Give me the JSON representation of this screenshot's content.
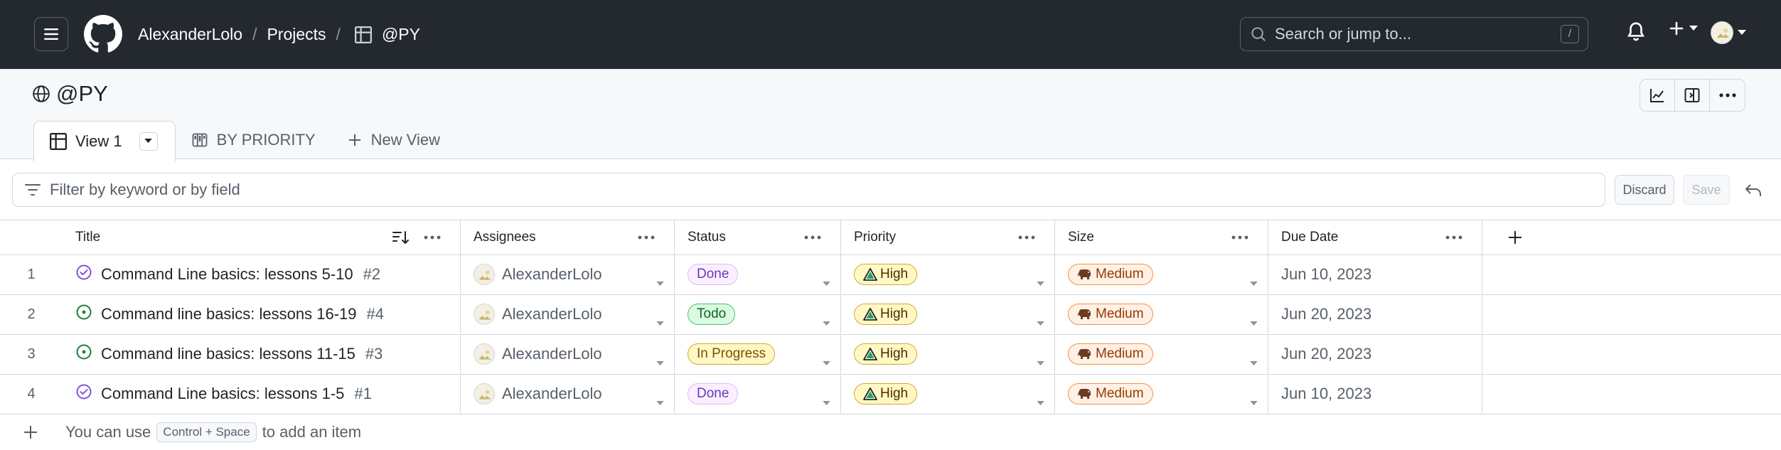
{
  "header": {
    "owner": "AlexanderLolo",
    "sep1": "/",
    "projects_label": "Projects",
    "sep2": "/",
    "project_name": "@PY",
    "search_placeholder": "Search or jump to...",
    "search_shortcut": "/"
  },
  "project": {
    "title": "@PY",
    "tabs": [
      {
        "label": "View 1",
        "icon": "table-icon",
        "active": true
      },
      {
        "label": "BY PRIORITY",
        "icon": "board-icon",
        "active": false
      },
      {
        "label": "New View",
        "icon": "plus-icon",
        "active": false
      }
    ]
  },
  "filter": {
    "placeholder": "Filter by keyword or by field",
    "discard_label": "Discard",
    "save_label": "Save"
  },
  "table": {
    "columns": [
      "Title",
      "Assignees",
      "Status",
      "Priority",
      "Size",
      "Due Date"
    ],
    "rows": [
      {
        "num": "1",
        "title": "Command Line basics: lessons 5-10",
        "issue": "#2",
        "state": "closed",
        "assignee": "AlexanderLolo",
        "status": "Done",
        "priority": "High",
        "size": "Medium",
        "due": "Jun 10, 2023"
      },
      {
        "num": "2",
        "title": "Command line basics: lessons 16-19",
        "issue": "#4",
        "state": "open",
        "assignee": "AlexanderLolo",
        "status": "Todo",
        "priority": "High",
        "size": "Medium",
        "due": "Jun 20, 2023"
      },
      {
        "num": "3",
        "title": "Command line basics: lessons 11-15",
        "issue": "#3",
        "state": "open",
        "assignee": "AlexanderLolo",
        "status": "In Progress",
        "priority": "High",
        "size": "Medium",
        "due": "Jun 20, 2023"
      },
      {
        "num": "4",
        "title": "Command Line basics: lessons 1-5",
        "issue": "#1",
        "state": "closed",
        "assignee": "AlexanderLolo",
        "status": "Done",
        "priority": "High",
        "size": "Medium",
        "due": "Jun 10, 2023"
      }
    ]
  },
  "footer": {
    "prefix": "You can use",
    "shortcut": "Control + Space",
    "suffix": "to add an item"
  },
  "colors": {
    "header_bg": "#24292f",
    "status_done": "#8250df",
    "status_todo": "#1a7f37",
    "status_in_progress": "#9a6700",
    "priority_high": "#bf8700",
    "size_medium": "#bc4c00"
  }
}
